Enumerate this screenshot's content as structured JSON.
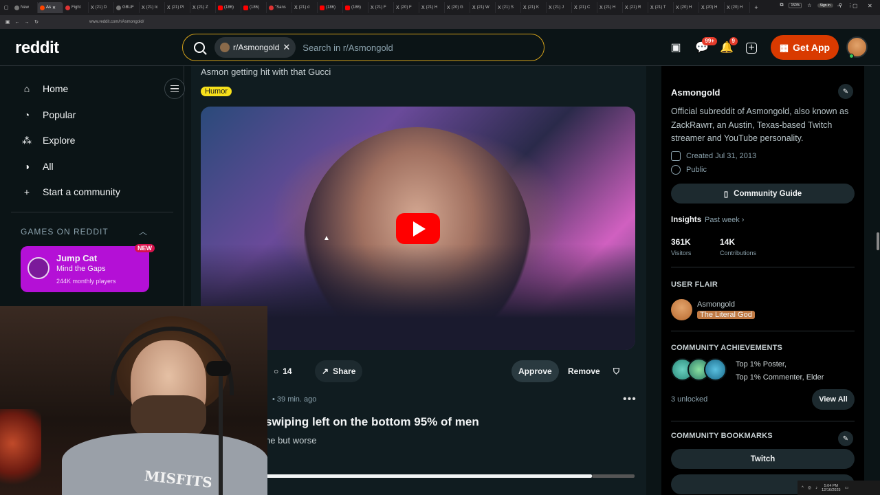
{
  "browser": {
    "tabs": [
      {
        "icon": "chrome",
        "label": "New"
      },
      {
        "icon": "reddit",
        "label": "As",
        "active": true
      },
      {
        "icon": "red",
        "label": "Fight"
      },
      {
        "icon": "x",
        "label": "(21) D"
      },
      {
        "icon": "gbuf",
        "label": "GBUF"
      },
      {
        "icon": "x",
        "label": "(21) Ic"
      },
      {
        "icon": "x",
        "label": "(21) Pl"
      },
      {
        "icon": "x",
        "label": "(21) Z"
      },
      {
        "icon": "yt",
        "label": "(186)"
      },
      {
        "icon": "yt",
        "label": "(186)"
      },
      {
        "icon": "red",
        "label": "\"Sans"
      },
      {
        "icon": "x",
        "label": "(21) d"
      },
      {
        "icon": "yt",
        "label": "(186)"
      },
      {
        "icon": "yt",
        "label": "(186)"
      },
      {
        "icon": "x",
        "label": "(21) F"
      },
      {
        "icon": "x",
        "label": "(20) F"
      },
      {
        "icon": "x",
        "label": "(21) H"
      },
      {
        "icon": "x",
        "label": "(20) G"
      },
      {
        "icon": "x",
        "label": "(21) W"
      },
      {
        "icon": "x",
        "label": "(21) S"
      },
      {
        "icon": "x",
        "label": "(21) K"
      },
      {
        "icon": "x",
        "label": "(21) J"
      },
      {
        "icon": "x",
        "label": "(21) C"
      },
      {
        "icon": "x",
        "label": "(21) H"
      },
      {
        "icon": "x",
        "label": "(21) R"
      },
      {
        "icon": "x",
        "label": "(21) T"
      },
      {
        "icon": "x",
        "label": "(20) H"
      },
      {
        "icon": "x",
        "label": "(20) H"
      },
      {
        "icon": "x",
        "label": "(20) H"
      }
    ],
    "url": "www.reddit.com/r/Asmongold/",
    "zoom": "150%",
    "signin": "Sign in"
  },
  "header": {
    "logo": "reddit",
    "chip": "r/Asmongold",
    "search_placeholder": "Search in r/Asmongold",
    "chat_badge": "99+",
    "notif_badge": "9",
    "getapp": "Get App"
  },
  "sidebar": {
    "items": [
      {
        "label": "Home",
        "icon": "home-icon"
      },
      {
        "label": "Popular",
        "icon": "popular-icon"
      },
      {
        "label": "Explore",
        "icon": "explore-icon"
      },
      {
        "label": "All",
        "icon": "all-icon"
      },
      {
        "label": "Start a community",
        "icon": "plus-icon"
      }
    ],
    "games_header": "GAMES ON REDDIT",
    "game": {
      "title": "Jump Cat",
      "subtitle": "Mind the Gaps",
      "players": "244K monthly players",
      "badge": "NEW"
    }
  },
  "post": {
    "title": "Asmon getting hit with that Gucci",
    "flair": "Humor",
    "comments": "14",
    "share": "Share",
    "approve": "Approve",
    "remove": "Remove"
  },
  "post2": {
    "time": "• 39 min. ago",
    "title": "swiping left on the bottom 95% of men",
    "sub": "ne but worse"
  },
  "webcam": {
    "shirt_text": "MISFITS"
  },
  "right": {
    "title": "Asmongold",
    "desc": "Official subreddit of Asmongold, also known as ZackRawrr, an Austin, Texas-based Twitch streamer and YouTube personality.",
    "created": "Created Jul 31, 2013",
    "visibility": "Public",
    "guide": "Community Guide",
    "insights": "Insights",
    "pastweek": "Past week ›",
    "visitors_v": "361K",
    "visitors_l": "Visitors",
    "contrib_v": "14K",
    "contrib_l": "Contributions",
    "flair_h": "USER FLAIR",
    "flair_name": "Asmongold",
    "flair_tag": "The Literal God",
    "ach_h": "COMMUNITY ACHIEVEMENTS",
    "ach1": "Top 1% Poster,",
    "ach2": "Top 1% Commenter, Elder",
    "unlocked": "3 unlocked",
    "viewall": "View All",
    "bm_h": "COMMUNITY BOOKMARKS",
    "twitch": "Twitch"
  },
  "taskbar": {
    "time": "5:04 PM",
    "date": "12/16/2025"
  },
  "colors": {
    "accent": "#d93a00",
    "flair": "#f7e01b",
    "game": "#b410d6",
    "bg": "#0b1416"
  }
}
